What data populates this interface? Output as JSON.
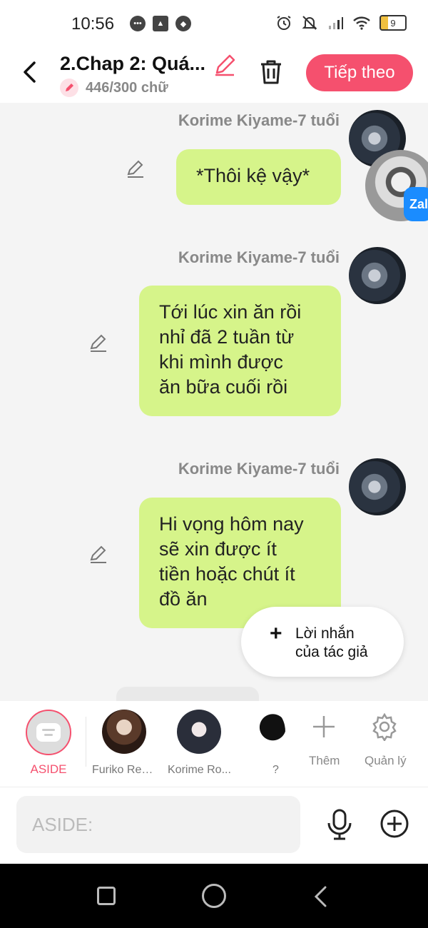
{
  "status_bar": {
    "time": "10:56",
    "battery": "9"
  },
  "header": {
    "chapter_title": "2.Chap 2: Quá...",
    "word_count": "446/300 chữ",
    "next_button": "Tiếp theo"
  },
  "messages": [
    {
      "sender": "Korime Kiyame-7 tuổi",
      "text": "*Thôi kệ vậy*"
    },
    {
      "sender": "Korime Kiyame-7 tuổi",
      "lines": [
        "Tới lúc xin ăn rồi",
        "nhỉ đã 2 tuần từ",
        "khi mình được",
        "ăn bữa cuối rồi"
      ]
    },
    {
      "sender": "Korime Kiyame-7 tuổi",
      "lines": [
        "Hi vọng hôm nay",
        "sẽ xin được ít",
        "tiền hoặc chút ít",
        "đồ ăn"
      ]
    }
  ],
  "floating": {
    "zalo_label": "Zal"
  },
  "author_note": {
    "line1": "Lời nhắn",
    "line2": "của tác giả"
  },
  "characters": {
    "aside_label": "ASIDE",
    "items": [
      {
        "label": "Furiko Res..."
      },
      {
        "label": "Korime Ro..."
      },
      {
        "label": "?"
      }
    ],
    "add_label": "Thêm",
    "manage_label": "Quản lý"
  },
  "input": {
    "placeholder": "ASIDE:"
  }
}
